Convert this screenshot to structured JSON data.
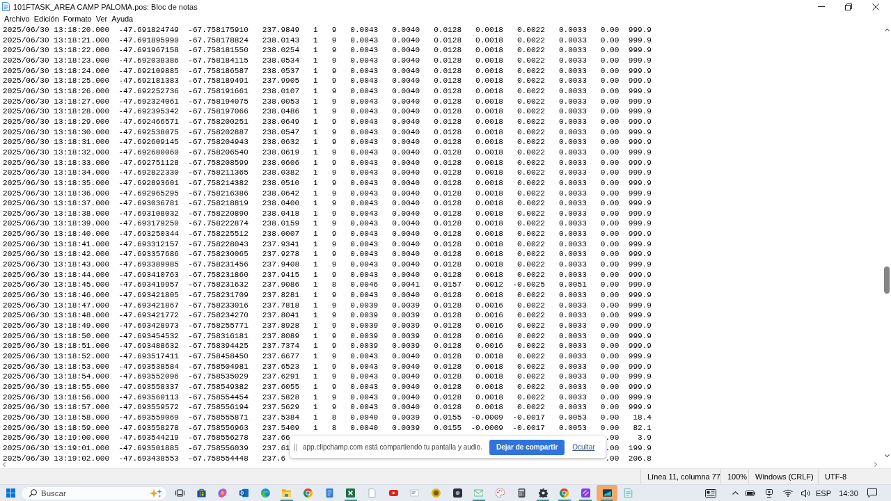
{
  "window": {
    "title": "101FTASK_AREA CAMP PALOMA.pos: Bloc de notas"
  },
  "menu": [
    "Archivo",
    "Edición",
    "Formato",
    "Ver",
    "Ayuda"
  ],
  "document": {
    "lines": [
      {
        "text": "2025/06/30 13:18:20.000  -47.691824749  -67.758175910   237.9849   1   9   0.0043   0.0040   0.0128   0.0018   0.0022   0.0033   0.00  999.9"
      },
      {
        "text": "2025/06/30 13:18:21.000  -47.691895990  -67.758178824   238.0143   1   9   0.0043   0.0040   0.0128   0.0018   0.0022   0.0033   0.00  999.9"
      },
      {
        "text": "2025/06/30 13:18:22.000  -47.691967158  -67.758181550   238.0254   1   9   0.0043   0.0040   0.0128   0.0018   0.0022   0.0033   0.00  999.9"
      },
      {
        "text": "2025/06/30 13:18:23.000  -47.692038386  -67.758184115   238.0534   1   9   0.0043   0.0040   0.0128   0.0018   0.0022   0.0033   0.00  999.9"
      },
      {
        "text": "2025/06/30 13:18:24.000  -47.692109885  -67.758186587   238.0537   1   9   0.0043   0.0040   0.0128   0.0018   0.0022   0.0033   0.00  999.9"
      },
      {
        "text": "2025/06/30 13:18:25.000  -47.692181383  -67.758189491   237.9905   1   9   0.0043   0.0040   0.0128   0.0018   0.0022   0.0033   0.00  999.9"
      },
      {
        "text": "2025/06/30 13:18:26.000  -47.692252736  -67.758191661   238.0107   1   9   0.0043   0.0040   0.0128   0.0018   0.0022   0.0033   0.00  999.9"
      },
      {
        "text": "2025/06/30 13:18:27.000  -47.692324061  -67.758194075   238.0053   1   9   0.0043   0.0040   0.0128   0.0018   0.0022   0.0033   0.00  999.9"
      },
      {
        "text": "2025/06/30 13:18:28.000  -47.692395342  -67.758197066   238.0486   1   9   0.0043   0.0040   0.0128   0.0018   0.0022   0.0033   0.00  999.9"
      },
      {
        "text": "2025/06/30 13:18:29.000  -47.692466571  -67.758200251   238.0649   1   9   0.0043   0.0040   0.0128   0.0018   0.0022   0.0033   0.00  999.9"
      },
      {
        "text": "2025/06/30 13:18:30.000  -47.692538075  -67.758202887   238.0547   1   9   0.0043   0.0040   0.0128   0.0018   0.0022   0.0033   0.00  999.9"
      },
      {
        "text": "2025/06/30 13:18:31.000  -47.692609145  -67.758204943   238.0632   1   9   0.0043   0.0040   0.0128   0.0018   0.0022   0.0033   0.00  999.9"
      },
      {
        "text": "2025/06/30 13:18:32.000  -47.692680060  -67.758206540   238.0619   1   9   0.0043   0.0040   0.0128   0.0018   0.0022   0.0033   0.00  999.9"
      },
      {
        "text": "2025/06/30 13:18:33.000  -47.692751128  -67.758208599   238.0606   1   9   0.0043   0.0040   0.0128   0.0018   0.0022   0.0033   0.00  999.9"
      },
      {
        "text": "2025/06/30 13:18:34.000  -47.692822330  -67.758211365   238.0382   1   9   0.0043   0.0040   0.0128   0.0018   0.0022   0.0033   0.00  999.9"
      },
      {
        "text": "2025/06/30 13:18:35.000  -47.692893601  -67.758214382   238.0510   1   9   0.0043   0.0040   0.0128   0.0018   0.0022   0.0033   0.00  999.9"
      },
      {
        "text": "2025/06/30 13:18:36.000  -47.692965295  -67.758216386   238.0642   1   9   0.0043   0.0040   0.0128   0.0018   0.0022   0.0033   0.00  999.9"
      },
      {
        "text": "2025/06/30 13:18:37.000  -47.693036781  -67.758218819   238.0400   1   9   0.0043   0.0040   0.0128   0.0018   0.0022   0.0033   0.00  999.9"
      },
      {
        "text": "2025/06/30 13:18:38.000  -47.693108032  -67.758220890   238.0418   1   9   0.0043   0.0040   0.0128   0.0018   0.0022   0.0033   0.00  999.9"
      },
      {
        "text": "2025/06/30 13:18:39.000  -47.693179250  -67.758222874   238.0159   1   9   0.0043   0.0040   0.0128   0.0018   0.0022   0.0033   0.00  999.9"
      },
      {
        "text": "2025/06/30 13:18:40.000  -47.693250344  -67.758225512   238.0007   1   9   0.0043   0.0040   0.0128   0.0018   0.0022   0.0033   0.00  999.9"
      },
      {
        "text": "2025/06/30 13:18:41.000  -47.693312157  -67.758228043   237.9341   1   9   0.0043   0.0040   0.0128   0.0018   0.0022   0.0033   0.00  999.9"
      },
      {
        "text": "2025/06/30 13:18:42.000  -47.693357686  -67.758230065   237.9278   1   9   0.0043   0.0040   0.0128   0.0018   0.0022   0.0033   0.00  999.9"
      },
      {
        "text": "2025/06/30 13:18:43.000  -47.693389985  -67.758231456   237.9408   1   9   0.0043   0.0040   0.0128   0.0018   0.0022   0.0033   0.00  999.9"
      },
      {
        "text": "2025/06/30 13:18:44.000  -47.693410763  -67.758231860   237.9415   1   9   0.0043   0.0040   0.0128   0.0018   0.0022   0.0033   0.00  999.9"
      },
      {
        "text": "2025/06/30 13:18:45.000  -47.693419957  -67.758231632   237.9086   1   8   0.0046   0.0041   0.0157   0.0012  -0.0025   0.0051   0.00  999.9"
      },
      {
        "text": "2025/06/30 13:18:46.000  -47.693421805  -67.758231709   237.8281   1   9   0.0043   0.0040   0.0128   0.0018   0.0022   0.0033   0.00  999.9"
      },
      {
        "text": "2025/06/30 13:18:47.000  -47.693421867  -67.758233016   237.7818   1   9   0.0039   0.0039   0.0128   0.0016   0.0022   0.0033   0.00  999.9"
      },
      {
        "text": "2025/06/30 13:18:48.000  -47.693421772  -67.758234270   237.8041   1   9   0.0039   0.0039   0.0128   0.0016   0.0022   0.0033   0.00  999.9"
      },
      {
        "text": "2025/06/30 13:18:49.000  -47.693428973  -67.758255771   237.8928   1   9   0.0039   0.0039   0.0128   0.0016   0.0022   0.0033   0.00  999.9"
      },
      {
        "text": "2025/06/30 13:18:50.000  -47.693454532  -67.758316181   237.8089   1   9   0.0039   0.0039   0.0128   0.0016   0.0022   0.0033   0.00  999.9"
      },
      {
        "text": "2025/06/30 13:18:51.000  -47.693488632  -67.758394425   237.7374   1   9   0.0039   0.0039   0.0128   0.0016   0.0022   0.0033   0.00  999.9"
      },
      {
        "text": "2025/06/30 13:18:52.000  -47.693517411  -67.758458450   237.6677   1   9   0.0043   0.0040   0.0128   0.0018   0.0022   0.0033   0.00  999.9"
      },
      {
        "text": "2025/06/30 13:18:53.000  -47.693538584  -67.758504981   237.6523   1   9   0.0043   0.0040   0.0128   0.0018   0.0022   0.0033   0.00  999.9"
      },
      {
        "text": "2025/06/30 13:18:54.000  -47.693552096  -67.758535029   237.6291   1   9   0.0043   0.0040   0.0128   0.0018   0.0022   0.0033   0.00  999.9"
      },
      {
        "text": "2025/06/30 13:18:55.000  -47.693558337  -67.758549382   237.6055   1   9   0.0043   0.0040   0.0128   0.0018   0.0022   0.0033   0.00  999.9"
      },
      {
        "text": "2025/06/30 13:18:56.000  -47.693560113  -67.758554454   237.5828   1   9   0.0043   0.0040   0.0128   0.0018   0.0022   0.0033   0.00  999.9"
      },
      {
        "text": "2025/06/30 13:18:57.000  -47.693559572  -67.758556194   237.5629   1   9   0.0043   0.0040   0.0128   0.0018   0.0022   0.0033   0.00  999.9"
      },
      {
        "text": "2025/06/30 13:18:58.000  -47.693559069  -67.758555871   237.5384   1   8   0.0040   0.0039   0.0155  -0.0009  -0.0017   0.0053   0.00   18.4"
      },
      {
        "text": "2025/06/30 13:18:59.000  -47.693558278  -67.758556963   237.5409   1   8   0.0040   0.0039   0.0155  -0.0009  -0.0017   0.0053   0.00   82.1"
      },
      {
        "text": "2025/06/30 13:19:00.000  -47.693544219  -67.758556278   237.66",
        "end_text": ".00    3.9"
      },
      {
        "text": "2025/06/30 13:19:01.000  -47.693501885  -67.758556039   237.61",
        "end_text": ".00  199.9"
      },
      {
        "text": "2025/06/30 13:19:02.000  -47.693438553  -67.758554448   237.6",
        "end_text": ".00  206.8"
      }
    ]
  },
  "share_notice": {
    "message": "app.clipchamp.com está compartiendo tu pantalla y audio.",
    "stop_button": "Dejar de compartir",
    "hide_link": "Ocultar"
  },
  "status_bar": {
    "position": "Línea 11, columna 77",
    "zoom": "100%",
    "line_ending": "Windows (CRLF)",
    "encoding": "UTF-8"
  },
  "taskbar": {
    "search": {
      "placeholder": "Buscar"
    },
    "apps": [
      {
        "running": false,
        "active": false
      },
      {
        "running": false,
        "active": false
      },
      {
        "running": false,
        "active": false
      },
      {
        "running": false,
        "active": false
      },
      {
        "running": false,
        "active": false
      },
      {
        "running": true,
        "active": false
      },
      {
        "running": false,
        "active": false
      },
      {
        "running": false,
        "active": false
      },
      {
        "running": true,
        "active": false
      },
      {
        "running": false,
        "active": false
      },
      {
        "running": false,
        "active": false
      },
      {
        "running": false,
        "active": false
      },
      {
        "running": false,
        "active": false
      },
      {
        "running": false,
        "active": false
      },
      {
        "running": true,
        "active": false
      },
      {
        "running": false,
        "active": false
      },
      {
        "running": false,
        "active": false
      },
      {
        "running": true,
        "active": false
      },
      {
        "running": true,
        "active": false
      },
      {
        "running": true,
        "active": false
      },
      {
        "running": true,
        "active": true
      },
      {
        "running": false,
        "active": false
      }
    ],
    "tray": {
      "language": "ESP",
      "time": "14:30"
    }
  }
}
